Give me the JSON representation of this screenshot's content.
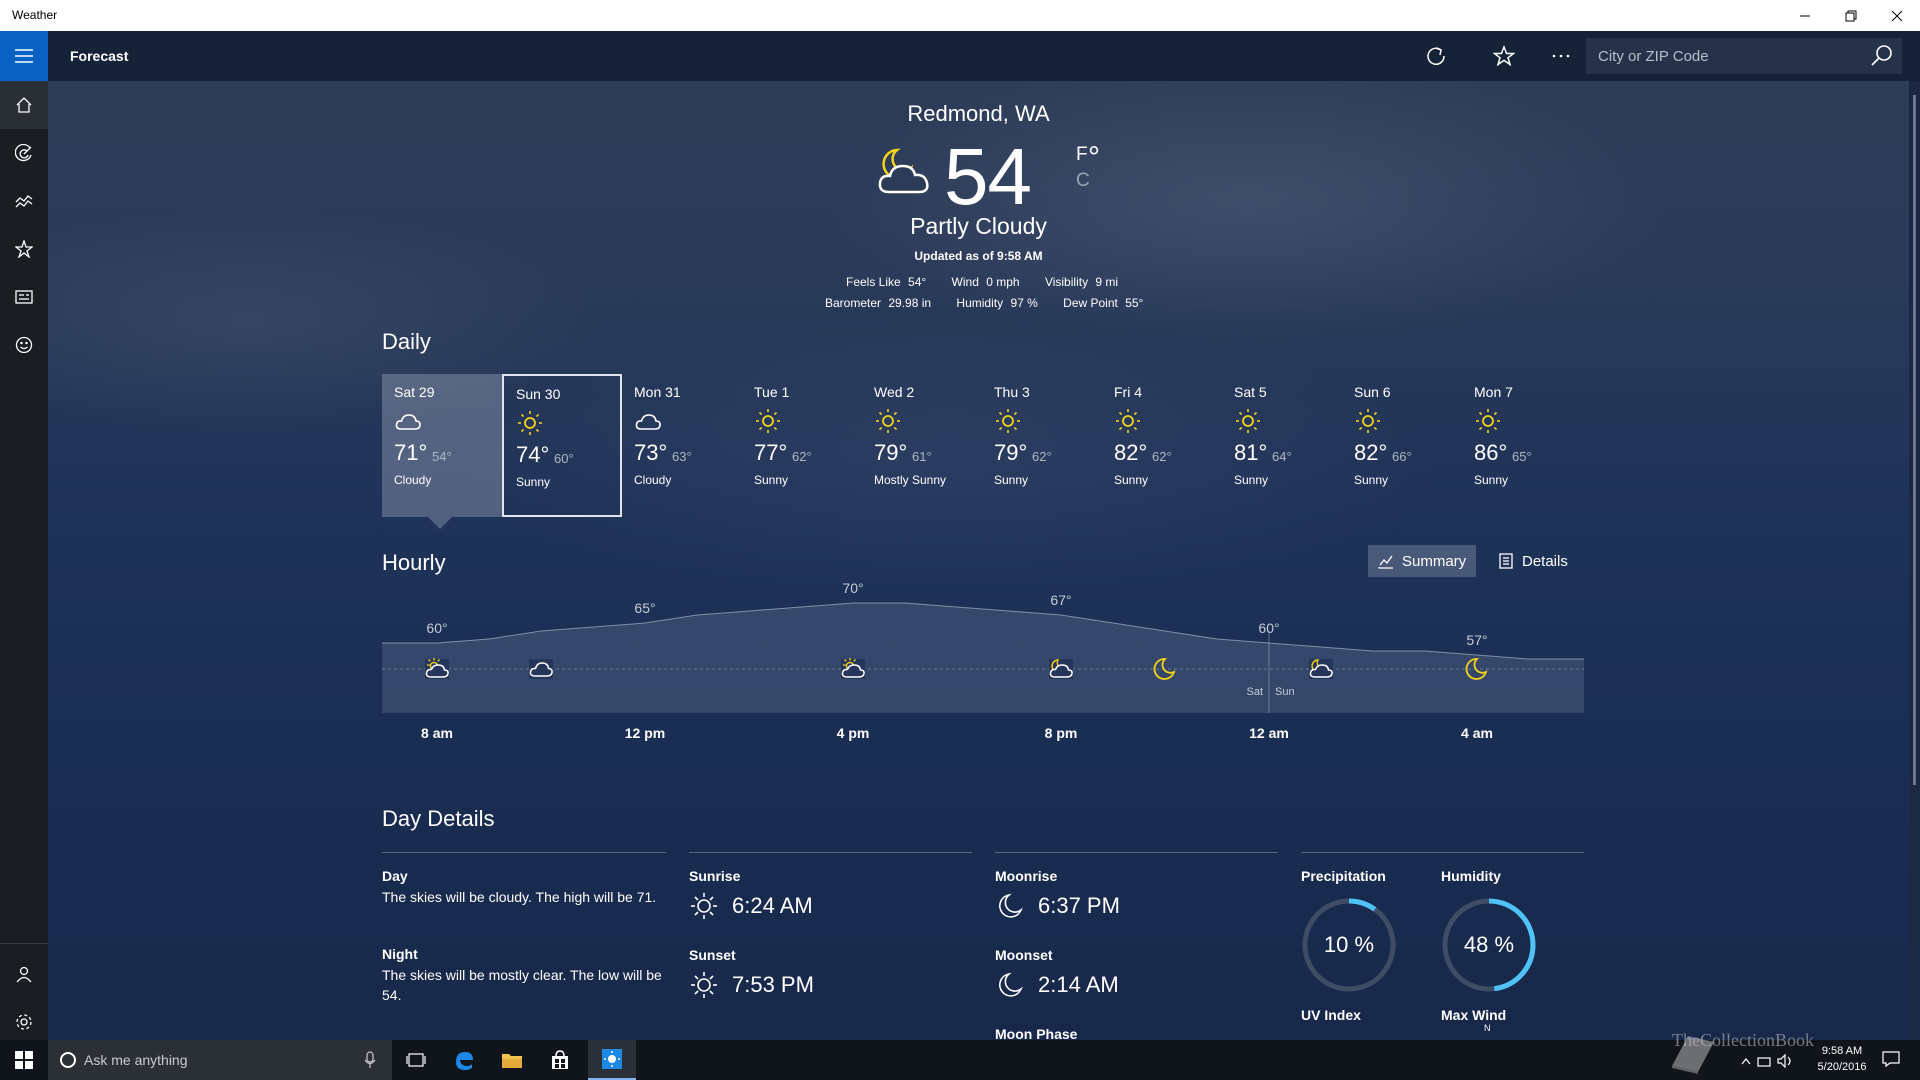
{
  "window": {
    "title": "Weather"
  },
  "commandbar": {
    "title": "Forecast",
    "search_placeholder": "City or ZIP Code"
  },
  "nav": {
    "items": [
      "home-icon",
      "radar-icon",
      "historical-icon",
      "favorites-icon",
      "news-icon",
      "feedback-icon"
    ],
    "bottom": [
      "account-icon",
      "settings-icon"
    ]
  },
  "current": {
    "location": "Redmond, WA",
    "temperature": "54",
    "degree": "°",
    "unit_f": "F",
    "unit_c": "C",
    "condition": "Partly Cloudy",
    "updated": "Updated as of 9:58 AM",
    "row1": [
      {
        "label": "Feels Like",
        "value": "54°"
      },
      {
        "label": "Wind",
        "value": "0 mph"
      },
      {
        "label": "Visibility",
        "value": "9 mi"
      }
    ],
    "row2": [
      {
        "label": "Barometer",
        "value": "29.98 in"
      },
      {
        "label": "Humidity",
        "value": "97 %"
      },
      {
        "label": "Dew Point",
        "value": "55°"
      }
    ]
  },
  "daily": {
    "heading": "Daily",
    "days": [
      {
        "name": "Sat 29",
        "hi": "71°",
        "lo": "54°",
        "cond": "Cloudy",
        "icon": "cloud-icon"
      },
      {
        "name": "Sun 30",
        "hi": "74°",
        "lo": "60°",
        "cond": "Sunny",
        "icon": "sun-icon"
      },
      {
        "name": "Mon 31",
        "hi": "73°",
        "lo": "63°",
        "cond": "Cloudy",
        "icon": "cloud-icon"
      },
      {
        "name": "Tue 1",
        "hi": "77°",
        "lo": "62°",
        "cond": "Sunny",
        "icon": "sun-icon"
      },
      {
        "name": "Wed 2",
        "hi": "79°",
        "lo": "61°",
        "cond": "Mostly Sunny",
        "icon": "sun-icon"
      },
      {
        "name": "Thu 3",
        "hi": "79°",
        "lo": "62°",
        "cond": "Sunny",
        "icon": "sun-icon"
      },
      {
        "name": "Fri 4",
        "hi": "82°",
        "lo": "62°",
        "cond": "Sunny",
        "icon": "sun-icon"
      },
      {
        "name": "Sat 5",
        "hi": "81°",
        "lo": "64°",
        "cond": "Sunny",
        "icon": "sun-icon"
      },
      {
        "name": "Sun 6",
        "hi": "82°",
        "lo": "66°",
        "cond": "Sunny",
        "icon": "sun-icon"
      },
      {
        "name": "Mon 7",
        "hi": "86°",
        "lo": "65°",
        "cond": "Sunny",
        "icon": "sun-icon"
      }
    ]
  },
  "hourly": {
    "heading": "Hourly",
    "summary_label": "Summary",
    "details_label": "Details",
    "time_labels": [
      "8 am",
      "12 pm",
      "4 pm",
      "8 pm",
      "12 am",
      "4 am"
    ],
    "temps": [
      {
        "hour": 0,
        "temp": 60,
        "label": "60°"
      },
      {
        "hour": 4,
        "temp": 65,
        "label": "65°"
      },
      {
        "hour": 8,
        "temp": 70,
        "label": "70°"
      },
      {
        "hour": 12,
        "temp": 67,
        "label": "67°"
      },
      {
        "hour": 16,
        "temp": 60,
        "label": "60°"
      },
      {
        "hour": 20,
        "temp": 57,
        "label": "57°"
      }
    ],
    "curve": [
      60,
      61,
      63,
      64,
      65,
      67,
      68,
      69,
      70,
      70,
      69,
      68,
      67,
      65,
      63,
      61,
      60,
      59,
      58,
      58,
      57,
      56
    ],
    "icons": [
      {
        "hour": 0,
        "icon": "partly-sunny-icon"
      },
      {
        "hour": 2,
        "icon": "cloud-icon"
      },
      {
        "hour": 8,
        "icon": "partly-sunny-icon"
      },
      {
        "hour": 12,
        "icon": "partly-cloudy-icon"
      },
      {
        "hour": 14,
        "icon": "moon-icon"
      },
      {
        "hour": 17,
        "icon": "partly-cloudy-icon"
      },
      {
        "hour": 20,
        "icon": "moon-icon"
      }
    ],
    "day_labels": [
      "Sat",
      "Sun"
    ]
  },
  "details": {
    "heading": "Day Details",
    "day_label": "Day",
    "day_text": "The skies will be cloudy. The high will be 71.",
    "night_label": "Night",
    "night_text": "The skies will be mostly clear. The low will be 54.",
    "sunrise_label": "Sunrise",
    "sunrise": "6:24 AM",
    "sunset_label": "Sunset",
    "sunset": "7:53 PM",
    "moonrise_label": "Moonrise",
    "moonrise": "6:37 PM",
    "moonset_label": "Moonset",
    "moonset": "2:14 AM",
    "moonphase_label": "Moon Phase",
    "precip_label": "Precipitation",
    "precip": "10 %",
    "precip_fraction": 0.1,
    "humidity_label": "Humidity",
    "humidity": "48 %",
    "humidity_fraction": 0.48,
    "uv_label": "UV Index",
    "wind_label": "Max Wind",
    "wind_dir": "N"
  },
  "taskbar": {
    "search_placeholder": "Ask me anything",
    "time": "9:58 AM",
    "date": "5/20/2016"
  },
  "watermark": "TheCollectionBook",
  "colors": {
    "accent": "#0a63c4",
    "ring": "#4fc3f7",
    "sun": "#f5d319"
  }
}
